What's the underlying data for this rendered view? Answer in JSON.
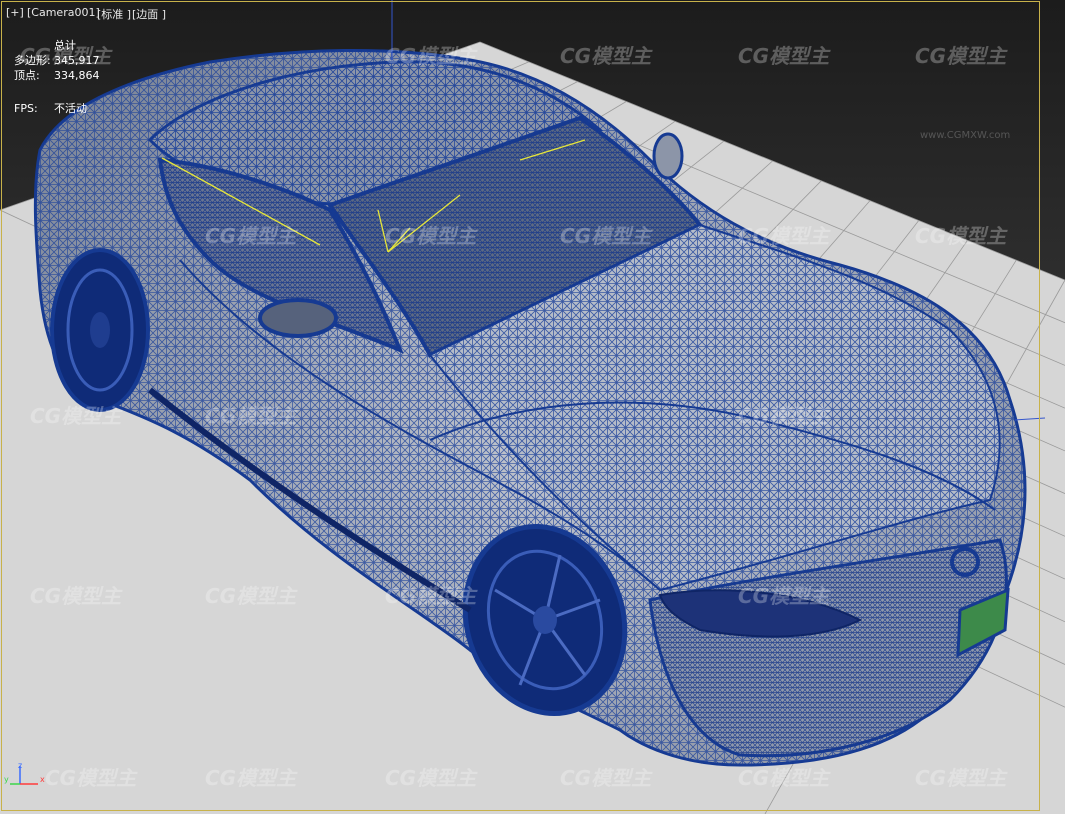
{
  "viewport": {
    "labels": {
      "plus": "[+]",
      "camera": "[Camera001]",
      "shading": "[标准 ]",
      "mode": "[边面 ]"
    },
    "stats": {
      "total_label": "总计",
      "poly_label": "多边形:",
      "poly_value": "345,917",
      "vert_label": "顶点:",
      "vert_value": "334,864",
      "fps_label": "FPS:",
      "fps_value": "不活动"
    },
    "watermark": {
      "text": "CG模型主",
      "url": "www.CGMXW.com"
    },
    "axis": {
      "x": "x",
      "y": "y",
      "z": "z"
    }
  },
  "colors": {
    "background_top": "#1f1f1f",
    "background_bottom": "#4a4a4a",
    "floor": "#d8d8d8",
    "floor_grid": "#9a9a9a",
    "wire": "#1a3f9a",
    "car_body": "#9fa6b3",
    "selection_border": "#c8b24a",
    "gizmo_line": "#e6e63a"
  }
}
